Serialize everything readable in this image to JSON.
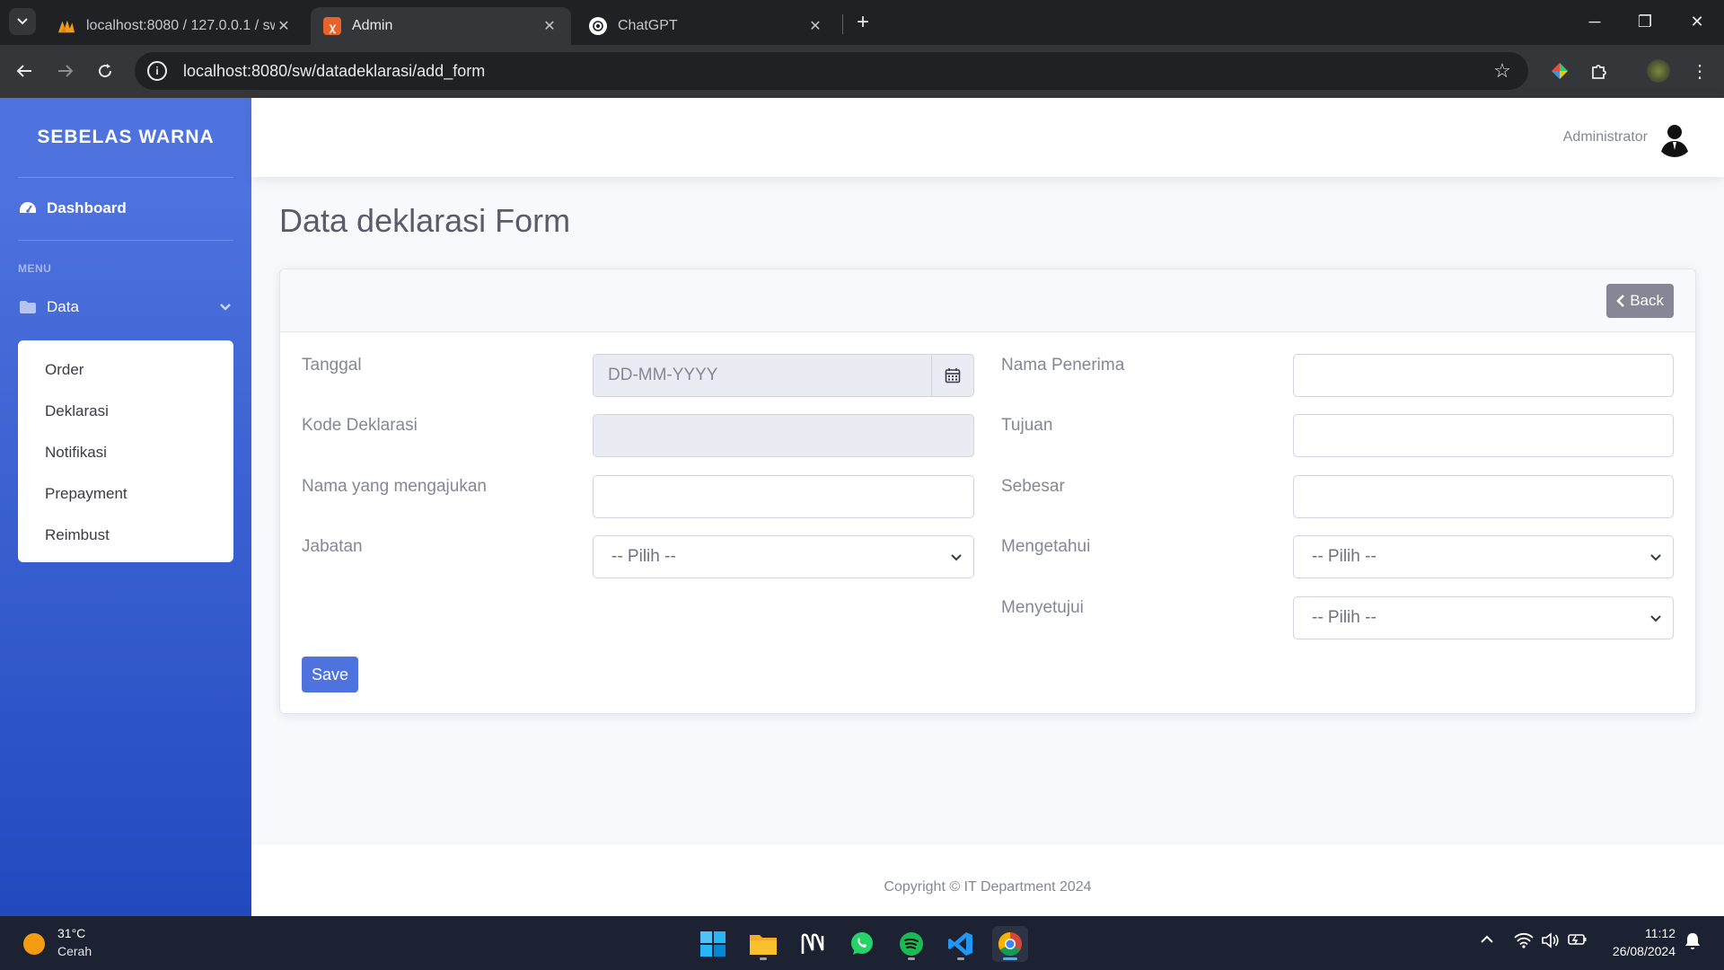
{
  "browser": {
    "tabs": [
      {
        "title": "localhost:8080 / 127.0.0.1 / sw /",
        "active": false
      },
      {
        "title": "Admin",
        "active": true
      },
      {
        "title": "ChatGPT",
        "active": false
      }
    ],
    "url": "localhost:8080/sw/datadeklarasi/add_form"
  },
  "sidebar": {
    "brand": "SEBELAS WARNA",
    "dashboard": "Dashboard",
    "heading": "MENU",
    "data_label": "Data",
    "submenu": [
      "Order",
      "Deklarasi",
      "Notifikasi",
      "Prepayment",
      "Reimbust"
    ]
  },
  "topbar": {
    "user": "Administrator"
  },
  "page": {
    "title": "Data deklarasi Form",
    "back_label": "Back",
    "save_label": "Save"
  },
  "form": {
    "tanggal_label": "Tanggal",
    "tanggal_placeholder": "DD-MM-YYYY",
    "kode_label": "Kode Deklarasi",
    "nama_label": "Nama yang mengajukan",
    "jabatan_label": "Jabatan",
    "jabatan_value": "-- Pilih --",
    "penerima_label": "Nama Penerima",
    "tujuan_label": "Tujuan",
    "sebesar_label": "Sebesar",
    "mengetahui_label": "Mengetahui",
    "mengetahui_value": "-- Pilih --",
    "menyetujui_label": "Menyetujui",
    "menyetujui_value": "-- Pilih --"
  },
  "footer": {
    "copyright": "Copyright © IT Department 2024"
  },
  "taskbar": {
    "temperature": "31°C",
    "weather": "Cerah",
    "time": "11:12",
    "date": "26/08/2024"
  },
  "colors": {
    "primary": "#4e73df",
    "secondary": "#858796",
    "sidebar_dark": "#224abe"
  }
}
